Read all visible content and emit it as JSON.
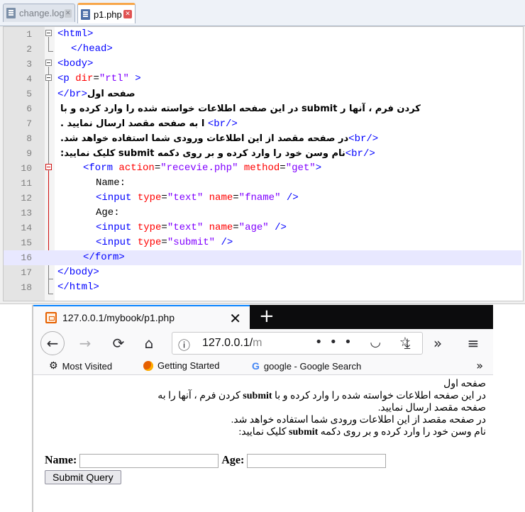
{
  "editor": {
    "tabs": [
      {
        "label": "change.log",
        "active": false
      },
      {
        "label": "p1.php",
        "active": true
      }
    ],
    "close_glyph": "✕",
    "line_numbers": [
      "1",
      "2",
      "3",
      "4",
      "5",
      "6",
      "7",
      "8",
      "9",
      "10",
      "11",
      "12",
      "13",
      "14",
      "15",
      "16",
      "17",
      "18"
    ],
    "lines": {
      "l1": "<html>",
      "l2": "</head>",
      "l3": "<body>",
      "l4_tag": "<p ",
      "l4_attr": "dir",
      "l4_eq": "=",
      "l4_val": "\"rtl\"",
      "l4_end": " >",
      "l5_fa": "صفحه اول",
      "l5_tag": "<br/>",
      "l6_fa": "کردن فرم ، آنها ر submit در این صفحه اطلاعات خواسته شده را وارد کرده و با",
      "l7_fa": ". ا به صفحه مقصد ارسال نمایید",
      "l7_tag": "<br/>",
      "l8_fa": ".در صفحه مقصد از این اطلاعات ورودی شما استفاده خواهد شد",
      "l8_tag": "<br/>",
      "l9_fa": ":کلیک نمایید submit نام وسن خود را وارد کرده و بر روی دکمه",
      "l9_tag": "<br/>",
      "l10_tag": "<form ",
      "l10_attr1": "action",
      "l10_val1": "\"recevie.php\"",
      "l10_attr2": " method",
      "l10_val2": "\"get\"",
      "l10_end": ">",
      "l11": "Name:",
      "l12_tag": "<input ",
      "l12_attr1": "type",
      "l12_val1": "\"text\"",
      "l12_attr2": " name",
      "l12_val2": "\"fname\"",
      "l12_end": " />",
      "l13": "Age:",
      "l14_tag": "<input ",
      "l14_attr1": "type",
      "l14_val1": "\"text\"",
      "l14_attr2": " name",
      "l14_val2": "\"age\"",
      "l14_end": " />",
      "l15_tag": "<input ",
      "l15_attr1": "type",
      "l15_val1": "\"submit\"",
      "l15_end": " />",
      "l16": "</form>",
      "l17": "</body>",
      "l18": "</html>"
    }
  },
  "browser": {
    "tab_title": "127.0.0.1/mybook/p1.php",
    "tab_close": "✕",
    "new_tab": "+",
    "url_host": "127.0.0.1/",
    "url_rest": "m",
    "url_icons": "••• ◡ ☆",
    "nav": {
      "back": "←",
      "forward": "→",
      "reload": "⟳",
      "home": "⌂",
      "download": "⤓",
      "more": "»",
      "menu": "≡"
    },
    "bookmarks": [
      {
        "label": "Most Visited",
        "icon": "gear-icon"
      },
      {
        "label": "Getting Started",
        "icon": "firefox-icon"
      },
      {
        "label": "google - Google Search",
        "icon": "google-icon"
      }
    ],
    "bookmarks_more": "»",
    "page": {
      "line1": "صفحه اول",
      "line2a": "در این صفحه اطلاعات خواسته شده را وارد کرده و با ",
      "line2b": "submit",
      "line2c": " کردن فرم ، آنها را به",
      "line3": "صفحه مقصد ارسال نمایید.",
      "line4": "در صفحه مقصد از این اطلاعات ورودی شما استفاده خواهد شد.",
      "line5a": "نام وسن خود را وارد کرده و بر روی دکمه ",
      "line5b": "submit",
      "line5c": " کلیک نمایید:",
      "name_label": "Name:",
      "age_label": "Age:",
      "submit_label": "Submit Query"
    }
  }
}
